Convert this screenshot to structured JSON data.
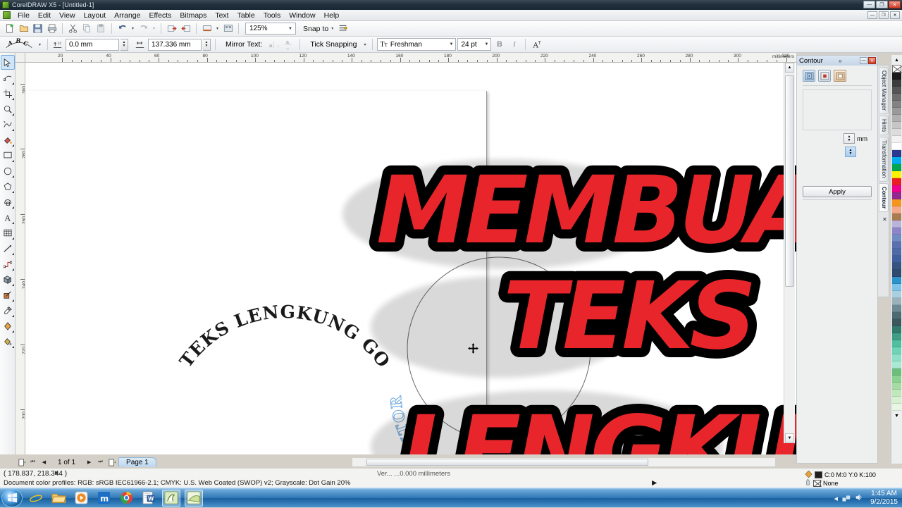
{
  "window": {
    "title": "CorelDRAW X5 - [Untitled-1]",
    "app_icon": "coreldraw-icon",
    "controls": {
      "minimize": "—",
      "maximize": "❐",
      "close": "✕"
    },
    "inner_controls": {
      "minimize": "—",
      "restore": "❐",
      "close": "✕"
    }
  },
  "menubar": {
    "items": [
      {
        "label": "File"
      },
      {
        "label": "Edit"
      },
      {
        "label": "View"
      },
      {
        "label": "Layout"
      },
      {
        "label": "Arrange"
      },
      {
        "label": "Effects"
      },
      {
        "label": "Bitmaps"
      },
      {
        "label": "Text"
      },
      {
        "label": "Table"
      },
      {
        "label": "Tools"
      },
      {
        "label": "Window"
      },
      {
        "label": "Help"
      }
    ]
  },
  "standard_toolbar": {
    "buttons": [
      {
        "name": "new-icon",
        "glyph": "🗋"
      },
      {
        "name": "open-icon",
        "glyph": "🗀"
      },
      {
        "name": "save-icon",
        "glyph": "🖫"
      },
      {
        "name": "print-icon",
        "glyph": "🖶"
      },
      {
        "name": "cut-icon",
        "glyph": "✂"
      },
      {
        "name": "copy-icon",
        "glyph": "⧉"
      },
      {
        "name": "paste-icon",
        "glyph": "📋"
      },
      {
        "name": "undo-icon",
        "glyph": "↩"
      },
      {
        "name": "redo-icon",
        "glyph": "↪"
      },
      {
        "name": "import-icon",
        "glyph": "⇲"
      },
      {
        "name": "export-icon",
        "glyph": "⇱"
      },
      {
        "name": "publish-pdf-icon",
        "glyph": "🖵"
      },
      {
        "name": "application-launcher-icon",
        "glyph": "▣"
      }
    ],
    "zoom_level": "125%",
    "snap_to_label": "Snap to",
    "options_icon": "options-icon"
  },
  "text_property_bar": {
    "text_on_path_preset_icon": "text-on-path-icon",
    "distance_from_path": {
      "label_icon": "vertical-offset-icon",
      "value": "0.0 mm"
    },
    "horizontal_offset": {
      "label_icon": "horizontal-offset-icon",
      "value": "137.336 mm"
    },
    "mirror_text_label": "Mirror Text:",
    "mirror_horizontal_icon": "mirror-horizontal-icon",
    "mirror_vertical_icon": "mirror-vertical-icon",
    "tick_snapping_label": "Tick Snapping",
    "font_family": "Freshman",
    "font_size": "24 pt",
    "bold_icon": "bold-icon",
    "italic_icon": "italic-icon",
    "text_properties_icon": "text-properties-icon"
  },
  "toolbox": {
    "tools": [
      {
        "name": "pick-tool",
        "glyph": "⬉",
        "selected": true
      },
      {
        "name": "shape-tool",
        "glyph": "⟡",
        "selected": false
      },
      {
        "name": "crop-tool",
        "glyph": "✂",
        "selected": false
      },
      {
        "name": "zoom-tool",
        "glyph": "🔍",
        "selected": false
      },
      {
        "name": "freehand-tool",
        "glyph": "✎",
        "selected": false
      },
      {
        "name": "smart-fill-tool",
        "glyph": "🖌",
        "selected": false
      },
      {
        "name": "rectangle-tool",
        "glyph": "▭",
        "selected": false
      },
      {
        "name": "ellipse-tool",
        "glyph": "◯",
        "selected": false
      },
      {
        "name": "polygon-tool",
        "glyph": "⬡",
        "selected": false
      },
      {
        "name": "basic-shapes-tool",
        "glyph": "⬠",
        "selected": false
      },
      {
        "name": "text-tool",
        "glyph": "A",
        "selected": false
      },
      {
        "name": "table-tool",
        "glyph": "▦",
        "selected": false
      },
      {
        "name": "dimension-tool",
        "glyph": "⟋",
        "selected": false
      },
      {
        "name": "connector-tool",
        "glyph": "⤳",
        "selected": false
      },
      {
        "name": "blend-tool",
        "glyph": "◨",
        "selected": false
      },
      {
        "name": "transparency-tool",
        "glyph": "◧",
        "selected": false
      },
      {
        "name": "eyedropper-tool",
        "glyph": "⚲",
        "selected": false
      },
      {
        "name": "fill-tool",
        "glyph": "◆",
        "selected": false
      },
      {
        "name": "interactive-fill-tool",
        "glyph": "◈",
        "selected": false
      }
    ]
  },
  "rulers": {
    "unit_label": "millimeters",
    "h_labels": [
      "20",
      "40",
      "60",
      "80",
      "100",
      "120",
      "140",
      "160",
      "180",
      "200",
      "220",
      "240",
      "260",
      "280",
      "300",
      "320"
    ],
    "v_labels": [
      "300",
      "280",
      "260",
      "240",
      "220",
      "200"
    ]
  },
  "canvas": {
    "curved_text_main": "TEKS LENGKUNG GO TUTOR",
    "curved_text_selected": "TEKS LENGKUNG GO TUTOR",
    "artwork_lines": [
      "MEMBUAT",
      "TEKS",
      "LENGKUNG"
    ],
    "artwork_color": "#e8252a",
    "artwork_outline": "#000000",
    "cursor_icon": "move-cursor"
  },
  "page_bar": {
    "first_icon": "first-page-icon",
    "prev_icon": "previous-page-icon",
    "next_icon": "next-page-icon",
    "last_icon": "last-page-icon",
    "add_page_icon": "add-page-icon",
    "page_count": "1 of 1",
    "tab_label": "Page 1"
  },
  "statusbar": {
    "coordinates": "( 178.837, 218.344 )",
    "color_profiles": "Document color profiles: RGB: sRGB IEC61966-2.1; CMYK: U.S. Web Coated (SWOP) v2; Grayscale: Dot Gain 20%",
    "center_hint": "Ver...   ...0.000 millimeters",
    "fill_label": "C:0 M:0 Y:0 K:100",
    "outline_label": "None",
    "fill_icon": "fill-icon",
    "outline_icon": "outline-pen-icon"
  },
  "docker": {
    "title": "Contour",
    "chevron": "»",
    "minimize": "—",
    "close": "✕",
    "modes": [
      {
        "name": "contour-to-center-icon",
        "selected": true
      },
      {
        "name": "contour-inside-icon",
        "selected": false
      },
      {
        "name": "contour-outside-icon",
        "selected": false
      }
    ],
    "offset_unit": "mm",
    "apply_label": "Apply",
    "tabs": [
      {
        "label": "Object Manager",
        "active": false
      },
      {
        "label": "Hints",
        "active": false
      },
      {
        "label": "Transformation",
        "active": false
      },
      {
        "label": "Contour",
        "active": true
      }
    ],
    "tab_close": "✕"
  },
  "palette": {
    "none_swatch": "no-color-swatch",
    "colors": [
      "#1a1a1a",
      "#3c3c3c",
      "#555555",
      "#6e6e6e",
      "#838383",
      "#9a9a9a",
      "#b0b0b0",
      "#c6c6c6",
      "#dcdcdc",
      "#f2f2f2",
      "#ffffff",
      "#2b3990",
      "#00aeef",
      "#00a651",
      "#fff200",
      "#ed1c24",
      "#ec008c",
      "#92278f",
      "#f7941e",
      "#f4a98a",
      "#a97c50",
      "#b9b4dc",
      "#8a86c8",
      "#6f8cc4",
      "#5c6fb1",
      "#4f6aa8",
      "#3f5f9e",
      "#35547f",
      "#2e4a6e",
      "#2b92cc",
      "#7fc4e8",
      "#a9cfe0",
      "#9bb2bb",
      "#6d8a94",
      "#4c6a72",
      "#3b575e",
      "#2f7a6b",
      "#3f9e85",
      "#4fbfa0",
      "#6fd4b6",
      "#8fe0c8",
      "#a8e8d4",
      "#6cbf7a",
      "#8bd18f",
      "#a6dca3",
      "#bfe8bb",
      "#d6f0d0",
      "#e8f7e4"
    ]
  },
  "taskbar": {
    "start_icon": "windows-start-orb",
    "items": [
      {
        "name": "internet-explorer-icon",
        "glyph": "e"
      },
      {
        "name": "windows-explorer-icon",
        "glyph": "🗂"
      },
      {
        "name": "media-player-icon",
        "glyph": "▶"
      },
      {
        "name": "maxthon-browser-icon",
        "glyph": "m"
      },
      {
        "name": "google-chrome-icon",
        "glyph": "◉"
      },
      {
        "name": "word-document-icon",
        "glyph": "W"
      },
      {
        "name": "coreldraw-taskbar-icon",
        "glyph": "✒",
        "active": true
      },
      {
        "name": "corel-photopaint-icon",
        "glyph": "◣",
        "active": true
      }
    ],
    "tray_icons": [
      "show-hidden-icons",
      "network-icon",
      "volume-icon"
    ],
    "clock_time": "1:45 AM",
    "clock_date": "9/2/2015"
  }
}
